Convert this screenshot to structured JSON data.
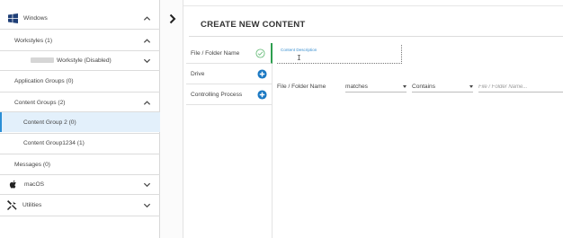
{
  "sidebar": {
    "windows": {
      "label": "Windows",
      "icon": "windows-logo-icon"
    },
    "workstyles": {
      "label": "Workstyles (1)"
    },
    "workstyle_item": {
      "label": "Workstyle (Disabled)"
    },
    "application_groups": {
      "label": "Application Groups (0)"
    },
    "content_groups": {
      "label": "Content Groups (2)"
    },
    "content_group_2": {
      "label": "Content Group 2 (0)"
    },
    "content_group_1234": {
      "label": "Content Group1234 (1)"
    },
    "messages": {
      "label": "Messages (0)"
    },
    "macos": {
      "label": "macOS",
      "icon": "apple-logo-icon"
    },
    "utilities": {
      "label": "Utilities",
      "icon": "tools-icon"
    }
  },
  "main": {
    "title": "CREATE NEW CONTENT",
    "tabs": [
      {
        "label": "File / Folder Name",
        "icon": "check-circle-icon",
        "state": "active"
      },
      {
        "label": "Drive",
        "icon": "plus-circle-icon"
      },
      {
        "label": "Controlling Process",
        "icon": "plus-circle-icon"
      }
    ],
    "description": {
      "label": "Content Description",
      "value": ""
    },
    "rule": {
      "label": "File / Folder Name",
      "match_select": "matches",
      "operator_select": "Contains",
      "value_placeholder": "File / Folder Name..."
    }
  },
  "colors": {
    "accent_blue": "#2b8fd6",
    "selected_bg": "#e3f0fb",
    "active_green": "#2e9e4f",
    "plus_blue": "#1a78c2"
  }
}
